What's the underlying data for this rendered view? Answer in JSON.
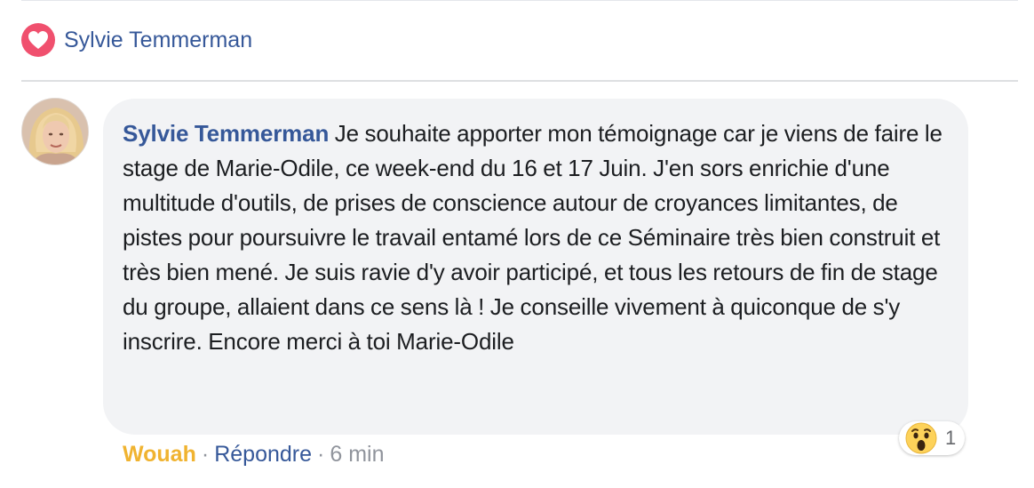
{
  "reactions_header": {
    "icon": "love-reaction-icon",
    "reactor_name": "Sylvie Temmerman"
  },
  "comment": {
    "author": "Sylvie Temmerman",
    "avatar": "avatar-photo",
    "text": "Je souhaite apporter mon témoignage car je viens de faire le stage de Marie-Odile, ce week-end du 16 et 17 Juin. J'en sors enrichie d'une multitude d'outils, de prises de conscience autour de croyances limitantes, de pistes pour poursuivre le travail entamé lors de ce Séminaire très bien construit et très bien mené. Je suis ravie d'y avoir participé, et tous les retours de fin de stage du groupe, allaient dans ce sens là ! Je conseille vivement à quiconque de s'y inscrire. Encore merci à toi Marie-Odile",
    "reaction": {
      "icon": "wow-reaction-icon",
      "count": "1"
    }
  },
  "actions": {
    "react_label": "Wouah",
    "separator": "·",
    "reply_label": "Répondre",
    "time": "6 min"
  },
  "colors": {
    "link_blue": "#365899",
    "wow_yellow": "#f0b330",
    "love_red": "#f0506e",
    "bubble_bg": "#f2f3f5",
    "meta_gray": "#90949c"
  }
}
